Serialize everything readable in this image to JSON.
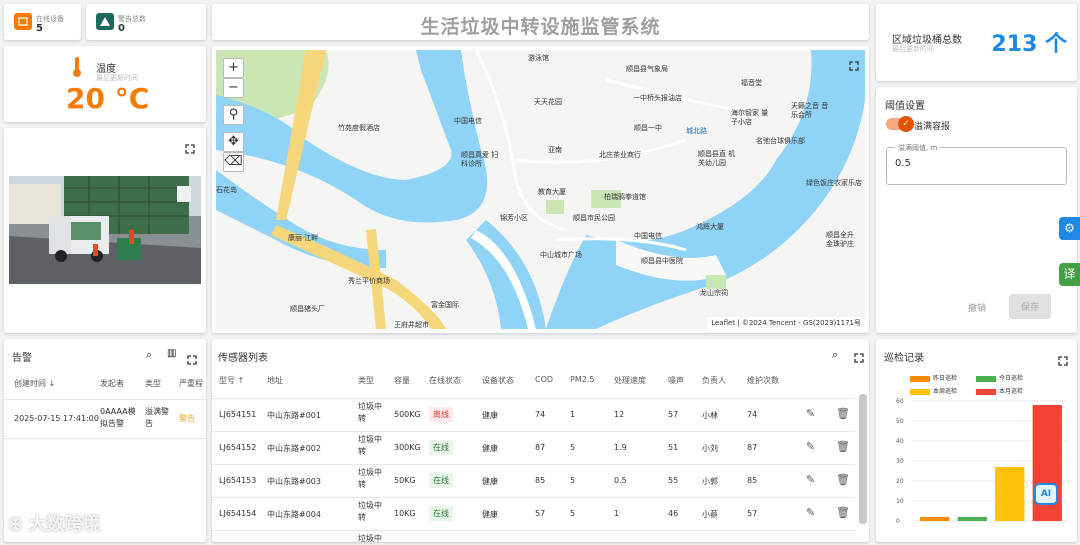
{
  "stats": {
    "online": {
      "label": "在线设备",
      "value": "5"
    },
    "alarm": {
      "label": "警告总数",
      "value": "0"
    }
  },
  "title": "生活垃圾中转设施监管系统",
  "temperature": {
    "label": "温度",
    "sub": "最后更新时间",
    "value": "20 °C"
  },
  "map": {
    "attribution": "Leaflet | ©2024 Tencent - GS(2023)1171号",
    "labels": [
      "游泳馆",
      "顺昌县气象局",
      "福音堂",
      "天天花园",
      "一中桥头报油店",
      "中国电信",
      "顺昌一中",
      "海尔智家 量子小店",
      "天籁之音 音乐会所",
      "竹苑度假酒店",
      "城北路",
      "名弛台球俱乐部",
      "亚南",
      "北庄茶业商行",
      "顺昌县直 机关幼儿园",
      "顺昌真爱 妇科诊所",
      "绿色饭庄农家乐店",
      "石花岛",
      "教育大厦",
      "柏瑞鸦拳道馆",
      "锦芳小区",
      "顺昌市民公园",
      "中国电信",
      "鸿辉大厦",
      "顺昌全升 金珠驴庄",
      "康丽·江畔",
      "中山城市广场",
      "顺昌县中医院",
      "秀兰平价商场",
      "龙山宗祠",
      "顺昌猪头厂",
      "富金国际",
      "王府井超市"
    ]
  },
  "region": {
    "label": "区域垃圾桶总数",
    "sub": "最后更新时间",
    "value": "213 个"
  },
  "threshold": {
    "title": "阈值设置",
    "overflow_label": "溢满容报",
    "field_label": "溢满阈值, m",
    "field_value": "0.5",
    "cancel": "撤销",
    "save": "保存"
  },
  "alarms": {
    "title": "告警",
    "columns": [
      "创建时间 ↓",
      "发起者",
      "类型",
      "严重程"
    ],
    "rows": [
      {
        "time": "2025-07-15 17:41:00",
        "initiator": "0AAAA模拟告警",
        "type": "溢满警告",
        "severity": "警告"
      }
    ]
  },
  "sensors": {
    "title": "传感器列表",
    "columns": [
      "型号 ↑",
      "地址",
      "类型",
      "容量",
      "在线状态",
      "设备状态",
      "COD",
      "PM2.5",
      "处理速度",
      "噪声",
      "负责人",
      "维护次数"
    ],
    "rows": [
      {
        "model": "LJ654151",
        "address": "中山东路#001",
        "type": "垃圾中转",
        "capacity": "500KG",
        "online": "离线",
        "status": "健康",
        "cod": "74",
        "pm25": "1",
        "speed": "12",
        "noise": "57",
        "owner": "小林",
        "maint": "74"
      },
      {
        "model": "LJ654152",
        "address": "中山东路#002",
        "type": "垃圾中转",
        "capacity": "300KG",
        "online": "在线",
        "status": "健康",
        "cod": "87",
        "pm25": "5",
        "speed": "1.9",
        "noise": "51",
        "owner": "小刘",
        "maint": "87"
      },
      {
        "model": "LJ654153",
        "address": "中山东路#003",
        "type": "垃圾中转",
        "capacity": "50KG",
        "online": "在线",
        "status": "健康",
        "cod": "85",
        "pm25": "5",
        "speed": "0.5",
        "noise": "55",
        "owner": "小郭",
        "maint": "85"
      },
      {
        "model": "LJ654154",
        "address": "中山东路#004",
        "type": "垃圾中转",
        "capacity": "10KG",
        "online": "在线",
        "status": "健康",
        "cod": "57",
        "pm25": "5",
        "speed": "1",
        "noise": "46",
        "owner": "小蔡",
        "maint": "57"
      },
      {
        "model": "",
        "address": "",
        "type": "垃圾中",
        "capacity": "",
        "online": "",
        "status": "",
        "cod": "",
        "pm25": "",
        "speed": "",
        "noise": "",
        "owner": "",
        "maint": ""
      }
    ]
  },
  "patrol": {
    "title": "巡检记录",
    "chart_data": {
      "type": "bar",
      "series": [
        {
          "name": "昨日巡检",
          "color": "#fb8c00",
          "value": 2
        },
        {
          "name": "今日巡检",
          "color": "#4caf50",
          "value": 2
        },
        {
          "name": "本周巡检",
          "color": "#ffc107",
          "value": 27
        },
        {
          "name": "本月巡检",
          "color": "#f44336",
          "value": 58
        }
      ],
      "yticks": [
        "0",
        "10",
        "20",
        "30",
        "40",
        "50",
        "60"
      ],
      "ylim": [
        0,
        60
      ]
    }
  },
  "watermark": "大数跨境",
  "icons": [
    "chip-icon",
    "warning-icon",
    "thermometer-icon",
    "fullscreen-icon",
    "search-icon",
    "columns-icon",
    "edit-icon",
    "delete-icon",
    "settings-icon",
    "translate-icon",
    "ai-icon"
  ]
}
